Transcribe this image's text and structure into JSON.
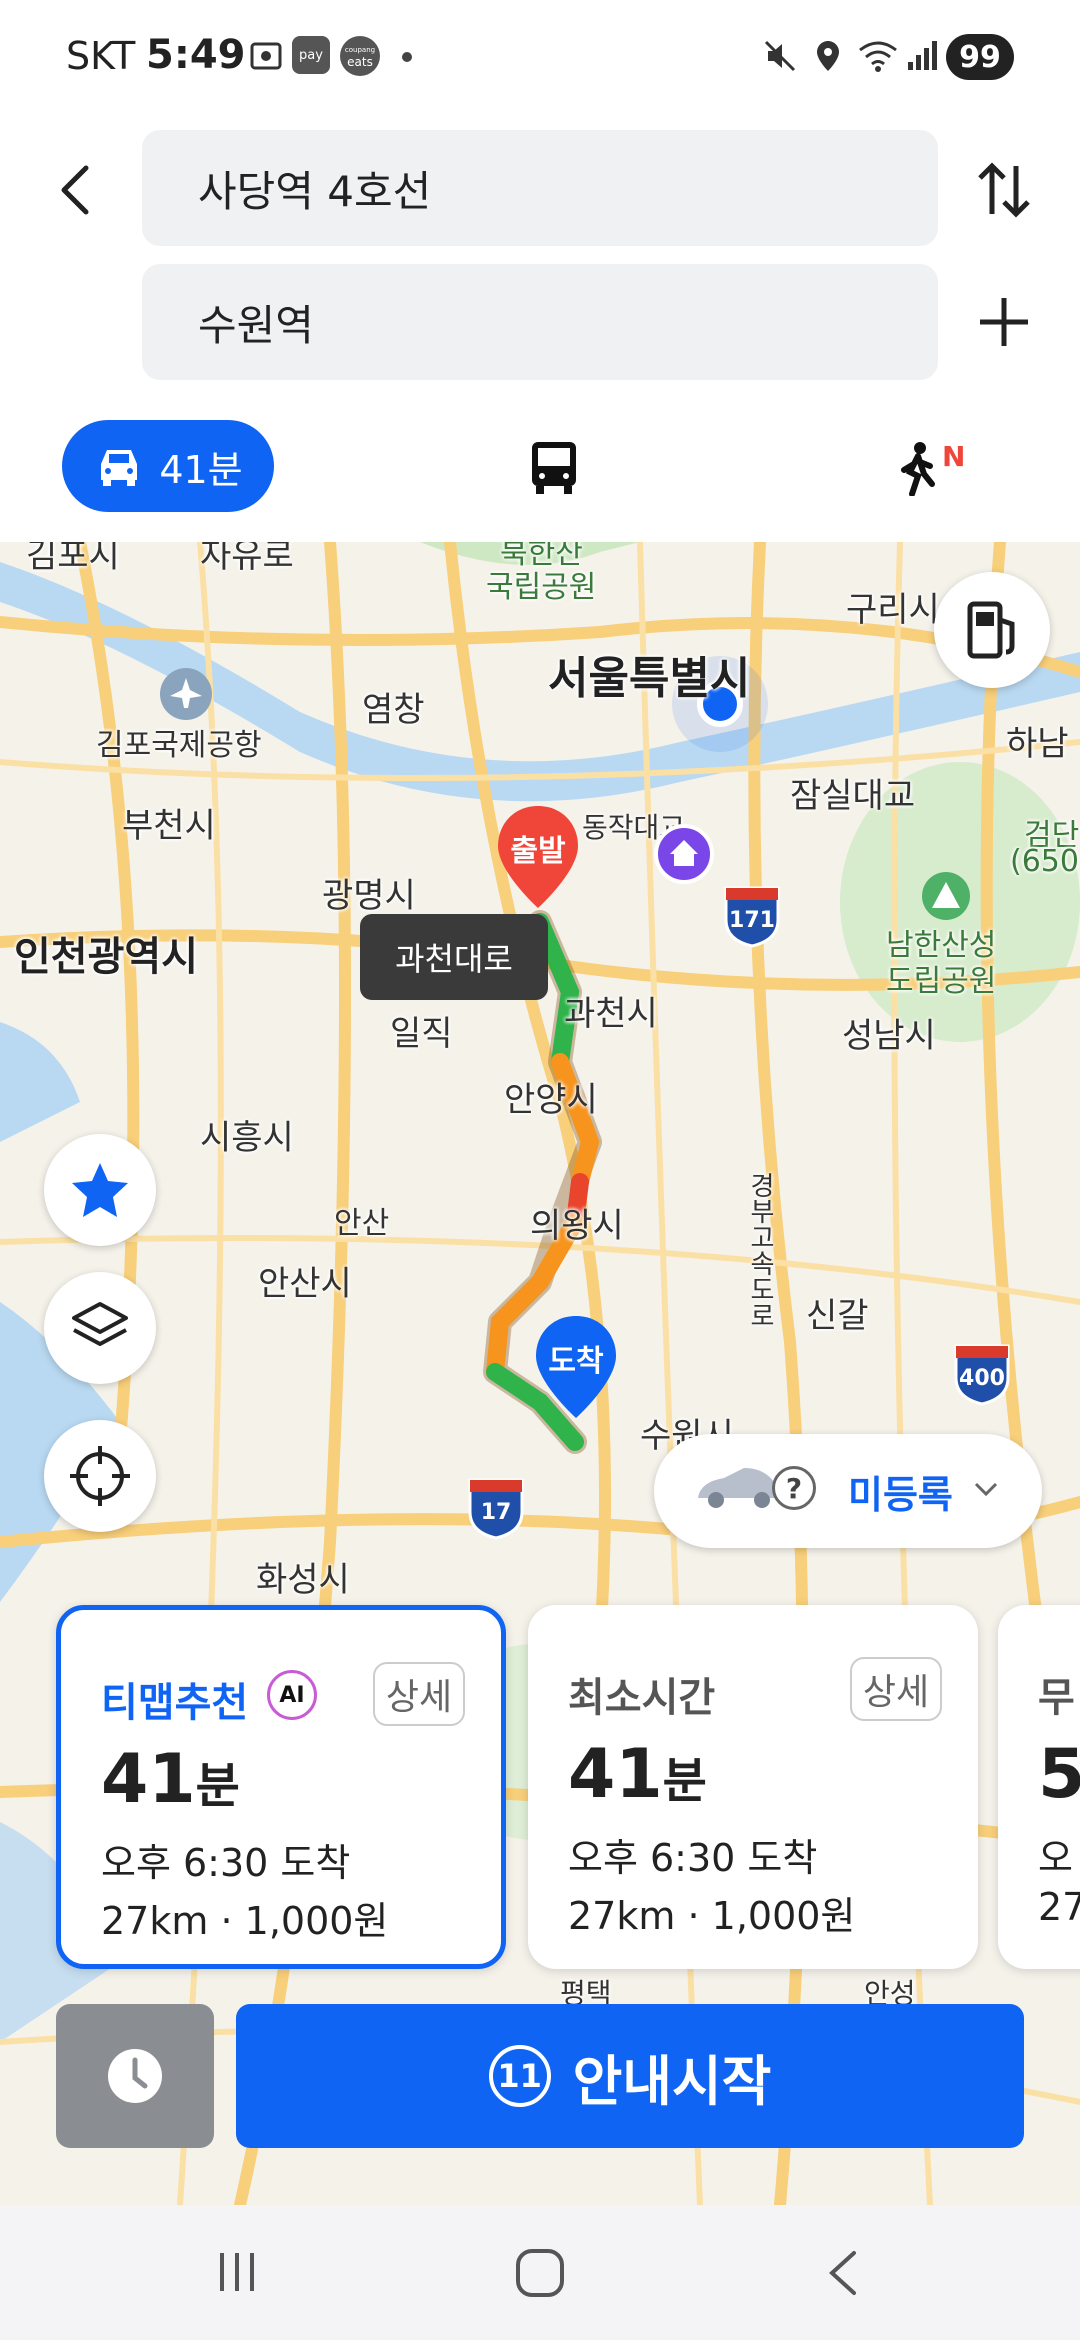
{
  "status": {
    "carrier": "SKT",
    "time": "5:49",
    "badge_pay": "pay",
    "badge_eats_top": "coupang",
    "badge_eats": "eats",
    "battery": "99"
  },
  "search": {
    "origin": "사당역 4호선",
    "destination": "수원역"
  },
  "modes": {
    "car_label": "41분",
    "walk_badge": "N"
  },
  "map": {
    "labels": [
      "김포시",
      "자유로",
      "북한산",
      "국립공원",
      "구리시",
      "서울특별시",
      "염창",
      "김포국제공항",
      "하남",
      "잠실대교",
      "검단",
      "(650",
      "부천시",
      "동작대교",
      "광명시",
      "인천광역시",
      "남한산성",
      "도립공원",
      "과천시",
      "일직",
      "성남시",
      "안양시",
      "시흥시",
      "경부고속도로",
      "의왕시",
      "안산",
      "안산시",
      "신갈",
      "수원시",
      "화성시",
      "평택",
      "안성"
    ],
    "road_tooltip": "과천대로",
    "start_marker": "출발",
    "end_marker": "도착",
    "highway_171": "171",
    "highway_400": "400",
    "highway_17": "17",
    "vehicle_status": "미등록"
  },
  "routes": [
    {
      "title": "티맵추천",
      "ai": "AI",
      "detail": "상세",
      "minutes": "41",
      "unit": "분",
      "arrival": "오후 6:30 도착",
      "distance": "27km",
      "fare": "1,000원",
      "selected": true
    },
    {
      "title": "최소시간",
      "detail": "상세",
      "minutes": "41",
      "unit": "분",
      "arrival": "오후 6:30 도착",
      "distance": "27km",
      "fare": "1,000원",
      "selected": false
    },
    {
      "title": "무",
      "minutes": "5",
      "arrival": "오",
      "distance": "27"
    }
  ],
  "bottom": {
    "start_number": "11",
    "start_label": "안내시작"
  },
  "colors": {
    "accent": "#1064f3",
    "route_green": "#2fb34a",
    "route_orange": "#f6941d",
    "route_red": "#e8452c",
    "start_red": "#f0463a"
  }
}
